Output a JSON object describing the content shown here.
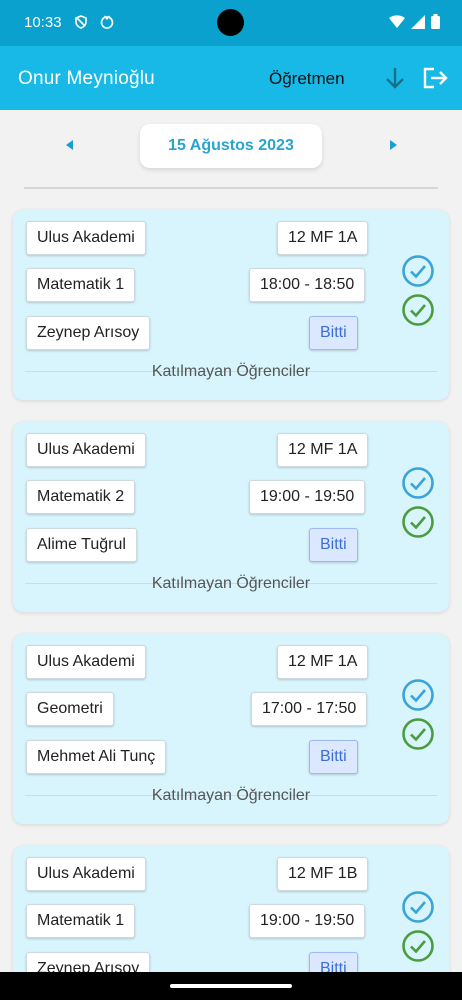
{
  "status_bar": {
    "time": "10:33",
    "icons": [
      "shield-icon",
      "face-icon",
      "wifi-icon",
      "signal-icon",
      "battery-icon"
    ]
  },
  "header": {
    "user_name": "Onur Meynioğlu",
    "role": "Öğretmen",
    "icons": [
      "download-arrow-icon",
      "logout-icon"
    ],
    "colors": {
      "status_bar": "#0aa1cf",
      "app_bar": "#18b9e6"
    }
  },
  "date_nav": {
    "date": "15 Ağustos 2023",
    "prev_icon": "triangle-left-icon",
    "next_icon": "triangle-right-icon"
  },
  "lessons": [
    {
      "school": "Ulus Akademi",
      "class": "12 MF 1A",
      "subject": "Matematik 1",
      "time": "18:00 - 18:50",
      "teacher": "Zeynep Arısoy",
      "status": "Bitti",
      "absent_label": "Katılmayan Öğrenciler"
    },
    {
      "school": "Ulus Akademi",
      "class": "12 MF 1A",
      "subject": "Matematik 2",
      "time": "19:00 - 19:50",
      "teacher": "Alime Tuğrul",
      "status": "Bitti",
      "absent_label": "Katılmayan Öğrenciler"
    },
    {
      "school": "Ulus Akademi",
      "class": "12 MF 1A",
      "subject": "Geometri",
      "time": "17:00 - 17:50",
      "teacher": "Mehmet Ali Tunç",
      "status": "Bitti",
      "absent_label": "Katılmayan Öğrenciler"
    },
    {
      "school": "Ulus Akademi",
      "class": "12 MF 1B",
      "subject": "Matematik 1",
      "time": "19:00 - 19:50",
      "teacher": "Zeynep Arısoy",
      "status": "Bitti",
      "absent_label": ""
    }
  ],
  "check_colors": {
    "blue": "#3aa3d8",
    "green": "#4a9c3e"
  }
}
